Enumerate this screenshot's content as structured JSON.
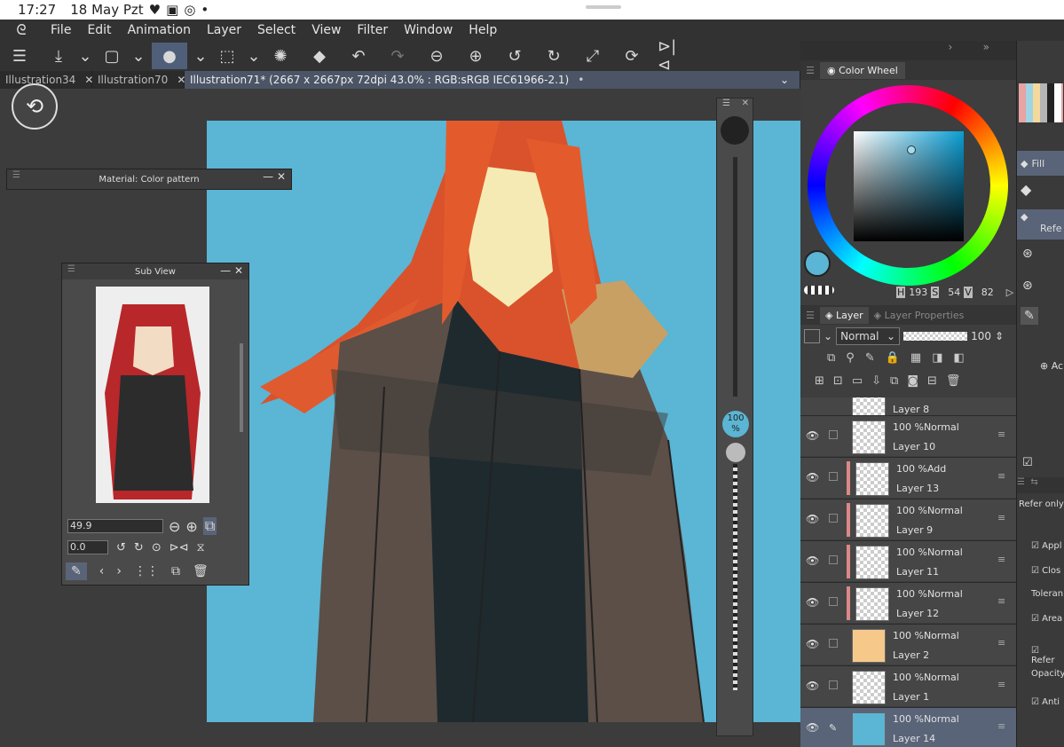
{
  "status": {
    "time": "17:27",
    "date": "18 May Pzt",
    "dot": "•"
  },
  "menu": [
    "File",
    "Edit",
    "Animation",
    "Layer",
    "Select",
    "View",
    "Filter",
    "Window",
    "Help"
  ],
  "tabs": [
    {
      "label": "Illustration34",
      "close": "✕"
    },
    {
      "label": "Illustration70",
      "close": "✕"
    },
    {
      "label": "Illustration71* (2667 x 2667px 72dpi 43.0% : RGB:sRGB IEC61966-2.1)",
      "close": "•"
    }
  ],
  "material_panel": {
    "title": "Material: Color pattern"
  },
  "subview": {
    "title": "Sub View",
    "zoom": "49.9",
    "rotation": "0.0"
  },
  "brush_size": {
    "value": "100",
    "unit": "%"
  },
  "color_wheel": {
    "title": "Color Wheel",
    "h_label": "H",
    "h": "193",
    "s_label": "S",
    "s": "54",
    "v_label": "V",
    "v": "82",
    "current_color": "#5bb5d4"
  },
  "layer_panel": {
    "tab_layer": "Layer",
    "tab_props": "Layer Properties",
    "blend_mode": "Normal",
    "opacity": "100",
    "layers": [
      {
        "name": "Layer 8",
        "mode": ""
      },
      {
        "name": "Layer 10",
        "mode": "100 %Normal"
      },
      {
        "name": "Layer 13",
        "mode": "100 %Add"
      },
      {
        "name": "Layer 9",
        "mode": "100 %Normal"
      },
      {
        "name": "Layer 11",
        "mode": "100 %Normal"
      },
      {
        "name": "Layer 12",
        "mode": "100 %Normal"
      },
      {
        "name": "Layer 2",
        "mode": "100 %Normal"
      },
      {
        "name": "Layer 1",
        "mode": "100 %Normal"
      },
      {
        "name": "Layer 14",
        "mode": "100 %Normal"
      }
    ]
  },
  "tool_panel": {
    "fill": "Fill",
    "refer": "Refe",
    "add": "Ac",
    "refer_only": "Refer only",
    "apply": "Appl",
    "close": "Clos",
    "tolerance": "Toleran",
    "area": "Area",
    "refer2": "Refer",
    "opacity": "Opacity",
    "anti": "Anti"
  },
  "colors": {
    "canvas_bg": "#5bb5d4",
    "accent": "#4f5f7a"
  }
}
